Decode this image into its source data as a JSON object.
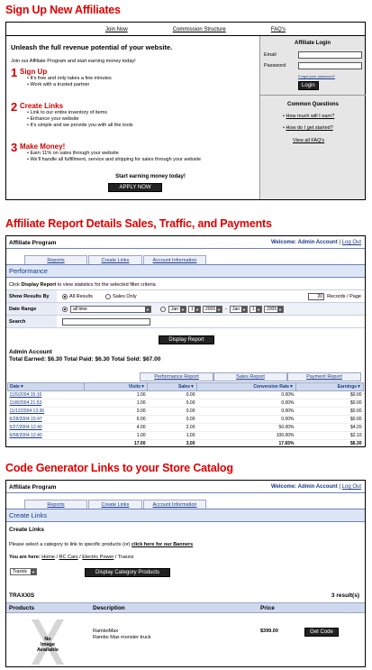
{
  "section1": {
    "heading": "Sign Up New Affiliates",
    "nav": [
      "Join Now",
      "Commission Structure",
      "FAQ's"
    ],
    "headline": "Unleash the full revenue potential of your website.",
    "intro": "Join our Affiliate Program and start earning money today!",
    "steps": [
      {
        "num": "1",
        "title": "Sign Up",
        "bullets": [
          "It's free and only takes a few minutes",
          "Work with a trusted partner"
        ]
      },
      {
        "num": "2",
        "title": "Create Links",
        "bullets": [
          "Link to our entire inventory of items",
          "Enhance your website",
          "It's simple and we provide you with all the tools"
        ]
      },
      {
        "num": "3",
        "title": "Make Money!",
        "bullets": [
          "Earn 11% on sales through your website",
          "We'll handle all fulfillment, service and shipping for sales through your website"
        ]
      }
    ],
    "cta_text": "Start earning money today!",
    "cta_button": "APPLY NOW",
    "login": {
      "title": "Affiliate Login",
      "email_label": "Email",
      "password_label": "Password",
      "forgot": "Forgot your password?",
      "button": "Login"
    },
    "questions": {
      "title": "Common Questions",
      "items": [
        "How much will I earn?",
        "How do I get started?"
      ],
      "view_all": "View all FAQ's"
    }
  },
  "section2": {
    "heading": "Affiliate Report Details Sales, Traffic, and Payments",
    "program_title": "Affiliate Program",
    "welcome": "Welcome: Admin Account",
    "separator": "|",
    "logout": "Log Out",
    "tabs": [
      "Reports",
      "Create Links",
      "Account Information"
    ],
    "bar_title": "Performance",
    "instructions_pre": "Click ",
    "instructions_bold": "Display Report",
    "instructions_post": " to view statistics for the selected filter criteria",
    "filter": {
      "show_label": "Show Results By",
      "opt_all": "All Results",
      "opt_sales": "Sales Only",
      "records_value": "20",
      "records_label": "Records / Page",
      "date_label": "Date Range",
      "date_select": "all time",
      "from_month": "Jan",
      "from_day": "1",
      "from_year": "2005",
      "dash": "-",
      "to_month": "Jan",
      "to_day": "1",
      "to_year": "2005",
      "search_label": "Search"
    },
    "display_button": "Display Report",
    "account_name": "Admin Account",
    "totals": "Total Earned: $6.30 Total Paid: $6.30 Total Sold: $67.00",
    "report_tabs": [
      "Performance Report",
      "Sales Report",
      "Payment Report"
    ],
    "columns": [
      "Date▼",
      "Visits▼",
      "Sales▼",
      "Conversion Rate▼",
      "Earnings▼"
    ],
    "rows": [
      [
        "11/5/2004 15:16",
        "1.00",
        "0.00",
        "0.00%",
        "$0.00"
      ],
      [
        "11/8/2004 21:53",
        "1.00",
        "0.00",
        "0.00%",
        "$0.00"
      ],
      [
        "11/12/2004 13:36",
        "3.00",
        "0.00",
        "0.00%",
        "$0.00"
      ],
      [
        "6/28/2004 15:47",
        "6.00",
        "0.00",
        "0.00%",
        "$0.00"
      ],
      [
        "5/27/2004 12:40",
        "4.00",
        "2.00",
        "50.00%",
        "$4.20"
      ],
      [
        "6/08/2004 12:40",
        "1.00",
        "1.00",
        "100.00%",
        "$2.10"
      ]
    ],
    "total_row": [
      "",
      "17.00",
      "3.00",
      "17.65%",
      "$6.30"
    ]
  },
  "section3": {
    "heading": "Code Generator Links to your Store Catalog",
    "program_title": "Affiliate Program",
    "welcome": "Welcome: Admin Account",
    "separator": "|",
    "logout": "Log Out",
    "tabs": [
      "Reports",
      "Create Links",
      "Account Information"
    ],
    "bar_title": "Create Links",
    "subtitle": "Create Links",
    "category_text": "Please select a category to link to specific products (or) ",
    "banners_link": "click here for our Banners",
    "you_are_here": "You are here:",
    "crumbs": [
      "Home",
      "RC Cars",
      "Electric Power",
      "Traxxis"
    ],
    "crumb_sep": " / ",
    "category_select": "Traxxis",
    "display_button": "Display Category Products",
    "results_title": "TRAXXIS",
    "results_count": "3 result(s)",
    "headers": [
      "Products",
      "Description",
      "Price"
    ],
    "product": {
      "image_text": [
        "No",
        "Image",
        "Available"
      ],
      "name": "RamboMax",
      "desc": "Rambo Max monster truck",
      "price": "$399.00",
      "button": "Get Code"
    }
  },
  "colors": {
    "heading_red": "#e00000",
    "nav_blue": "#1a3a8a",
    "bar_bg": "#dde6f6"
  }
}
